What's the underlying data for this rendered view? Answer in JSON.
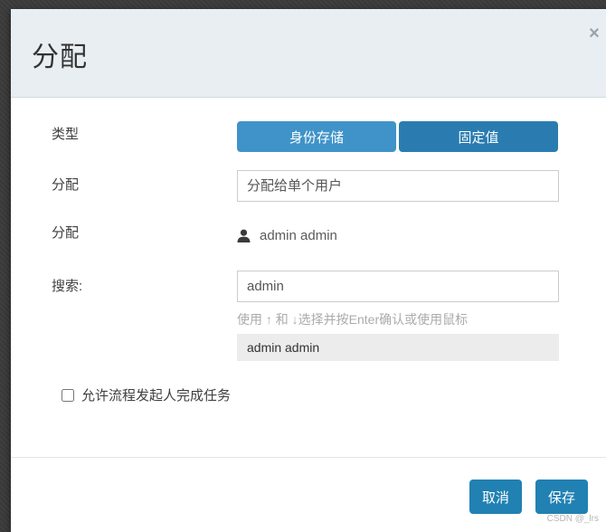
{
  "modal": {
    "title": "分配",
    "close_glyph": "×"
  },
  "form": {
    "type_row": {
      "label": "类型",
      "options": [
        {
          "label": "身份存储",
          "selected": true
        },
        {
          "label": "固定值",
          "selected": false
        }
      ]
    },
    "assign_select_row": {
      "label": "分配",
      "value": "分配给单个用户"
    },
    "assignee_row": {
      "label": "分配",
      "user": "admin admin"
    },
    "search_row": {
      "label": "搜索:",
      "value": "admin",
      "hint": "使用 ↑ 和 ↓选择并按Enter确认或使用鼠标"
    },
    "results": [
      "admin admin"
    ],
    "checkbox_row": {
      "label": "允许流程发起人完成任务",
      "checked": false
    }
  },
  "footer": {
    "cancel_label": "取消",
    "save_label": "保存"
  },
  "watermark": "CSDN @_lrs",
  "colors": {
    "toggle_selected": "#4093c8",
    "toggle_unselected": "#2a7cb0",
    "footer_button": "#2181b2",
    "header_bg": "#e9eef2",
    "backdrop": "#3d3d3d",
    "result_bg": "#ececec"
  }
}
